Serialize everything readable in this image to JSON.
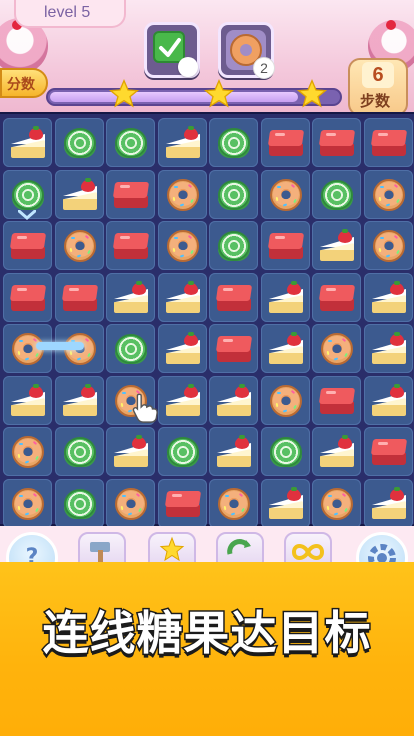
{
  "header": {
    "level_label": "level 5",
    "score_label": "分数",
    "target_count": "2",
    "steps_value": "6",
    "steps_label": "步数",
    "progress_fraction": 0.86,
    "stars": 3
  },
  "board": {
    "rows": 8,
    "cols": 8,
    "grid": [
      [
        "cake",
        "swirl",
        "swirl",
        "cake",
        "swirl",
        "jelly",
        "jelly",
        "jelly"
      ],
      [
        "swirl",
        "cake",
        "jelly",
        "donut",
        "swirl",
        "donut",
        "swirl",
        "donut"
      ],
      [
        "jelly",
        "donut",
        "jelly",
        "donut",
        "swirl",
        "jelly",
        "cake",
        "donut"
      ],
      [
        "jelly",
        "jelly",
        "cake",
        "cake",
        "jelly",
        "cake",
        "jelly",
        "cake"
      ],
      [
        "donut",
        "donut",
        "swirl",
        "cake",
        "jelly",
        "cake",
        "donut",
        "cake"
      ],
      [
        "cake",
        "cake",
        "donut",
        "cake",
        "cake",
        "donut",
        "jelly",
        "cake"
      ],
      [
        "donut",
        "swirl",
        "cake",
        "swirl",
        "cake",
        "swirl",
        "cake",
        "jelly"
      ],
      [
        "donut",
        "swirl",
        "donut",
        "jelly",
        "donut",
        "cake",
        "donut",
        "cake"
      ]
    ]
  },
  "toolbar": {
    "help_icon": "?"
  },
  "banner": {
    "text": "连线糖果达目标"
  }
}
